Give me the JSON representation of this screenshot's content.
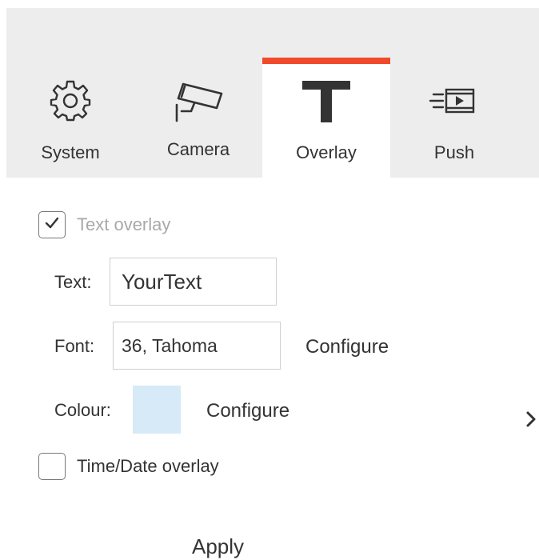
{
  "tabs": [
    {
      "id": "system",
      "label": "System",
      "icon": "gear-icon"
    },
    {
      "id": "camera",
      "label": "Camera",
      "icon": "security-camera-icon"
    },
    {
      "id": "overlay",
      "label": "Overlay",
      "icon": "text-t-icon",
      "active": true
    },
    {
      "id": "push",
      "label": "Push",
      "icon": "fast-forward-video-icon"
    }
  ],
  "colors": {
    "accent": "#f0492c",
    "tab_bar_bg": "#ededed",
    "selected_colour": "#d6eaf8"
  },
  "text_overlay": {
    "checked": true,
    "label": "Text overlay"
  },
  "text_field": {
    "label": "Text:",
    "value": "YourText"
  },
  "font_field": {
    "label": "Font:",
    "value": "36, Tahoma",
    "configure": "Configure"
  },
  "colour": {
    "label": "Colour:",
    "configure": "Configure"
  },
  "time_date_overlay": {
    "checked": false,
    "label": "Time/Date overlay"
  },
  "next_icon": "chevron-right-icon",
  "apply_label": "Apply"
}
